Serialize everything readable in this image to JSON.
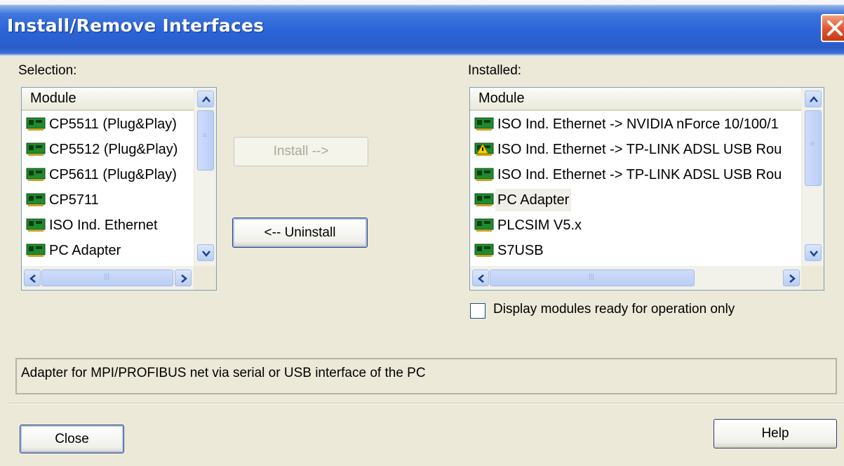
{
  "window": {
    "title": "Install/Remove Interfaces"
  },
  "selection": {
    "label": "Selection:",
    "column_header": "Module",
    "items": [
      {
        "label": "CP5511 (Plug&Play)",
        "icon": "network-card-icon"
      },
      {
        "label": "CP5512 (Plug&Play)",
        "icon": "network-card-icon"
      },
      {
        "label": "CP5611 (Plug&Play)",
        "icon": "network-card-icon"
      },
      {
        "label": "CP5711",
        "icon": "network-card-icon"
      },
      {
        "label": "ISO Ind. Ethernet",
        "icon": "network-card-icon"
      },
      {
        "label": "PC Adapter",
        "icon": "network-card-icon"
      }
    ]
  },
  "buttons": {
    "install": "Install -->",
    "uninstall": "<-- Uninstall",
    "close": "Close",
    "help": "Help"
  },
  "installed": {
    "label": "Installed:",
    "column_header": "Module",
    "items": [
      {
        "label": "ISO Ind. Ethernet -> NVIDIA nForce 10/100/1",
        "icon": "network-card-icon"
      },
      {
        "label": "ISO Ind. Ethernet -> TP-LINK ADSL USB Rou",
        "icon": "network-card-warning-icon"
      },
      {
        "label": "ISO Ind. Ethernet -> TP-LINK ADSL USB Rou",
        "icon": "network-card-icon"
      },
      {
        "label": "PC Adapter",
        "icon": "network-card-icon",
        "selected": true
      },
      {
        "label": "PLCSIM V5.x",
        "icon": "network-card-icon"
      },
      {
        "label": "S7USB",
        "icon": "network-card-icon"
      }
    ]
  },
  "checkbox": {
    "label": "Display modules ready for operation only",
    "checked": false
  },
  "description": "Adapter for MPI/PROFIBUS net via serial or USB interface of the PC",
  "colors": {
    "title_blue": "#2b64d8",
    "dialog_bg": "#ece9d8",
    "close_red": "#e0532d"
  }
}
